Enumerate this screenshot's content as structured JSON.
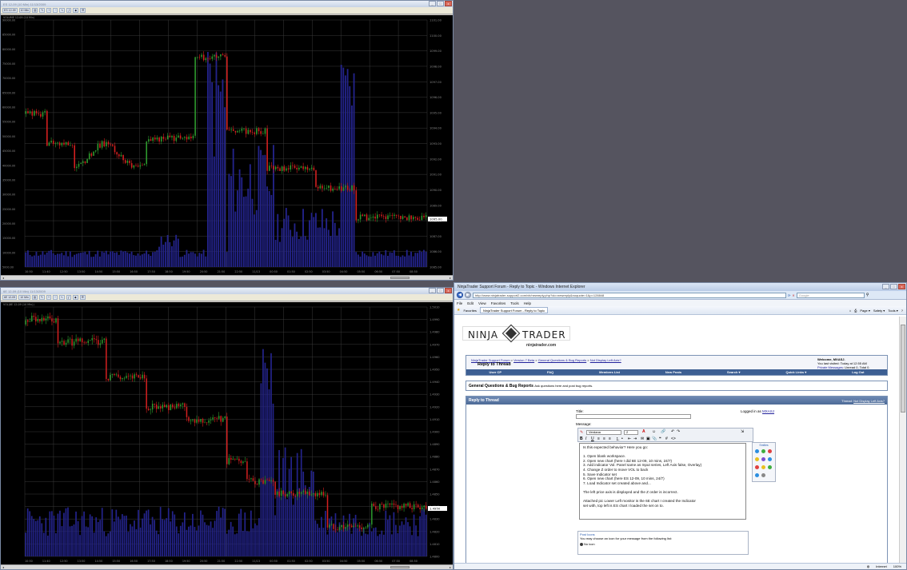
{
  "top_chart_window": {
    "title": "ES 12-09 (10 Min)  11/13/2009",
    "instrument": "ES 12-09",
    "interval": "10 Min",
    "panel_label": "VOLUME 12-09 (10 Min)",
    "last_price": "1095.00",
    "price_ticks": [
      "1101.00",
      "1100.00",
      "1099.00",
      "1098.00",
      "1097.00",
      "1096.00",
      "1095.00",
      "1094.00",
      "1093.00",
      "1092.00",
      "1091.00",
      "1090.00",
      "1089.00",
      "1088.00",
      "1087.00",
      "1086.00",
      "1085.00"
    ],
    "volume_ticks": [
      "90000.00",
      "85000.00",
      "80000.00",
      "75000.00",
      "70000.00",
      "65000.00",
      "60000.00",
      "55000.00",
      "50000.00",
      "45000.00",
      "40000.00",
      "35000.00",
      "30000.00",
      "25000.00",
      "20000.00",
      "15000.00",
      "10000.00",
      "5000.00"
    ],
    "time_ticks": [
      "10:50",
      "11:10",
      "11:40",
      "12:10",
      "12:50",
      "13:20",
      "13:50",
      "14:20",
      "14:50",
      "15:20",
      "15:50",
      "16:20",
      "16:50",
      "17:20",
      "17:50",
      "18:20",
      "18:50",
      "19:20",
      "19:50",
      "20:20",
      "20:50",
      "21:20",
      "21:50",
      "22:20",
      "22:50",
      "23:20",
      "11/13",
      "00:20",
      "00:50",
      "01:20",
      "01:50",
      "02:20",
      "02:50",
      "03:20",
      "03:50",
      "04:20",
      "04:50",
      "05:20",
      "05:50",
      "06:20",
      "06:50",
      "07:20",
      "07:50",
      "08:20",
      "08:50",
      "09:20"
    ]
  },
  "bottom_chart_window": {
    "title": "6E 12-09 (10 Min)  11/13/2009",
    "instrument": "6E 12-09",
    "interval": "10 Min",
    "panel_label": "VOL(6E 12-09 (10 Min))",
    "last_price": "1.4950",
    "price_ticks": [
      "1.5010",
      "1.4990",
      "1.4980",
      "1.4970",
      "1.4960",
      "1.4950",
      "1.4940",
      "1.4930",
      "1.4920",
      "1.4910",
      "1.4900",
      "1.4890",
      "1.4880",
      "1.4870",
      "1.4860",
      "1.4850",
      "1.4840",
      "1.4830",
      "1.4820",
      "1.4810",
      "1.4800"
    ]
  },
  "ie": {
    "title": "NinjaTrader Support Forum - Reply to Topic - Windows Internet Explorer",
    "address": "http://www.ninjatrader-support2.com/vb/newreply.php?do=newreply&noquote=1&p=128848",
    "search_placeholder": "Google",
    "menu": [
      "File",
      "Edit",
      "View",
      "Favorites",
      "Tools",
      "Help"
    ],
    "favorites_label": "Favorites",
    "tab_label": "NinjaTrader Support Forum - Reply to Topic",
    "command_bar": [
      "Page ▾",
      "Safety ▾",
      "Tools ▾"
    ],
    "status_zone": "Internet",
    "zoom": "100%"
  },
  "forum": {
    "logo_word_left": "NINJA",
    "logo_word_right": "TRADER",
    "logo_url": "ninjatrader.com",
    "breadcrumb": [
      "NinjaTrader Support Forum",
      "Version 7 Beta",
      "General Questions & Bug Reports",
      "Not Display Left Axis?"
    ],
    "page_heading": "Reply to Thread",
    "welcome": "Welcome, MXASJ.",
    "last_visited": "You last visited: Today at 12:55 AM",
    "private_messages": "Private Messages",
    "pm_counts": ": Unread 0, Total 0.",
    "nav": [
      "User CP",
      "FAQ",
      "Members List",
      "New Posts",
      "Search ▾",
      "Quick Links ▾",
      "Log Out"
    ],
    "forum_title": "General Questions & Bug Reports",
    "forum_desc": "Ask questions here and post bug reports.",
    "reply_header": "Reply to Thread",
    "thread_label": "Thread:",
    "thread_name": "Not Display Left Axis?",
    "title_label": "Title:",
    "logged_in_as": "Logged in as",
    "username": "MXASJ",
    "message_label": "Message:",
    "font_name": "Verdana",
    "font_size": "2",
    "smilies_label": "Smilies",
    "message_text": "Is this expected behavior? Here you go:\n\n1. Open blank workspace.\n2. Open new chart (here I did 6E 12-09, 10 mins, 24/7)\n3. Add indicator Vol. Panel same as Input series, Left Axis false, Overlay)\n4. Change Z order to move VOL to back\n5. Save Indicator set\n6. Open new chart (here ES 12-09, 10 mins, 24/7)\n7. Load Indicator set created above and...\n\nThe left price axis is displayed and the Z order is incorrect.\n\nAttached pic Lower Left monitor is the 6E chart I created the Indicator\nset with, top left is ES chart I loaded the set on to.",
    "post_icons_label": "Post Icons",
    "post_icons_desc": "You may choose an icon for your message from the following list:",
    "no_icon": "No icon"
  },
  "colors": {
    "up_candle": "#2e9a2e",
    "down_candle": "#d42020",
    "volume_bar": "#23238a",
    "forum_nav": "#3d5f93",
    "desktop": "#55545f"
  }
}
